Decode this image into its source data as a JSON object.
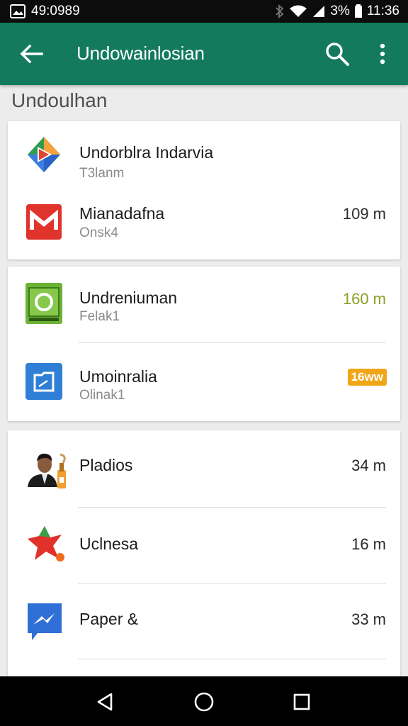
{
  "status_bar": {
    "left_icon": "image-notification-icon",
    "left_text": "49:0989",
    "battery_text": "3%",
    "time": "11:36"
  },
  "app_bar": {
    "title": "Undowainlosian",
    "color": "#137a5e"
  },
  "section": {
    "title": "Undoulhan"
  },
  "card1": {
    "items": [
      {
        "name": "Undorblra Indarvia",
        "sub": "T3lanm",
        "size": "",
        "icon": "play-store-icon"
      },
      {
        "name": "Mianadafna",
        "sub": "Onsk4",
        "size": "109 m",
        "icon": "gmail-icon"
      }
    ]
  },
  "card2": {
    "items": [
      {
        "name": "Undreniuman",
        "sub": "Felak1",
        "size": "160 m",
        "icon": "green-app-icon"
      },
      {
        "name": "Umoinralia",
        "sub": "Olinak1",
        "size": "16ww",
        "icon": "blue-folder-icon"
      }
    ]
  },
  "card3": {
    "items": [
      {
        "name": "Pladios",
        "size": "34 m",
        "icon": "person-avatar-icon"
      },
      {
        "name": "Uclnesa",
        "size": "16 m",
        "icon": "red-bird-icon"
      },
      {
        "name": "Paper &",
        "size": "33 m",
        "icon": "blue-messenger-icon"
      }
    ]
  },
  "nav_bar": {
    "back": "back-triangle-icon",
    "home": "home-circle-icon",
    "recents": "recents-square-icon"
  }
}
